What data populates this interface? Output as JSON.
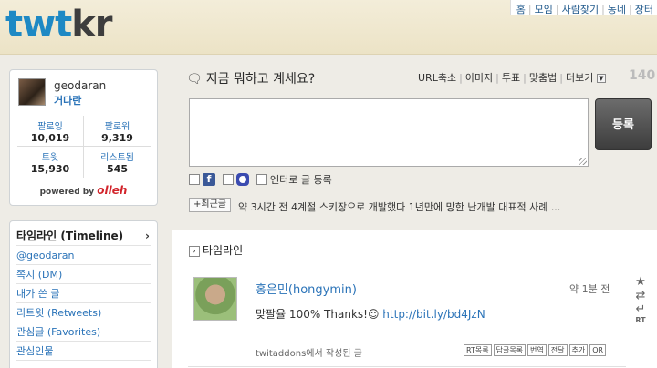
{
  "header": {
    "logo_primary": "twt",
    "logo_secondary": "kr",
    "nav": [
      "홈",
      "모임",
      "사람찾기",
      "동네",
      "장터"
    ]
  },
  "profile": {
    "username": "geodaran",
    "nickname": "거다란",
    "stats": [
      {
        "label": "팔로잉",
        "value": "10,019"
      },
      {
        "label": "팔로워",
        "value": "9,319"
      },
      {
        "label": "트윗",
        "value": "15,930"
      },
      {
        "label": "리스트됨",
        "value": "545"
      }
    ],
    "powered_by": "powered by",
    "powered_brand": "olleh"
  },
  "menu": {
    "items": [
      "타임라인 (Timeline)",
      "@geodaran",
      "쪽지 (DM)",
      "내가 쓴 글",
      "리트윗 (Retweets)",
      "관심글 (Favorites)",
      "관심인물"
    ]
  },
  "composer": {
    "title": "지금 뭐하고 계세요?",
    "tools": [
      "URL축소",
      "이미지",
      "투표",
      "맞춤법",
      "더보기"
    ],
    "counter": "140",
    "submit_label": "등록",
    "enter_label": "엔터로 글 등록"
  },
  "recent": {
    "button": "+최근글",
    "text": "약 3시간 전 4계절 스키장으로 개발했다 1년만에 망한 난개발 대표적 사례 ..."
  },
  "timeline": {
    "heading": "타임라인",
    "tweet": {
      "user": "홍은민(hongymin)",
      "time": "약 1분 전",
      "text": "맞팔율 100% Thanks!☺ ",
      "link": "http://bit.ly/bd4JzN",
      "source": "twitaddons에서 작성된 글",
      "actions": [
        "RT목록",
        "답글목록",
        "번역",
        "전달",
        "추가",
        "QR"
      ]
    }
  },
  "colors": {
    "logo_blue": "#1e89c4",
    "link_blue": "#2a73b8",
    "olleh_red": "#d2232a"
  }
}
